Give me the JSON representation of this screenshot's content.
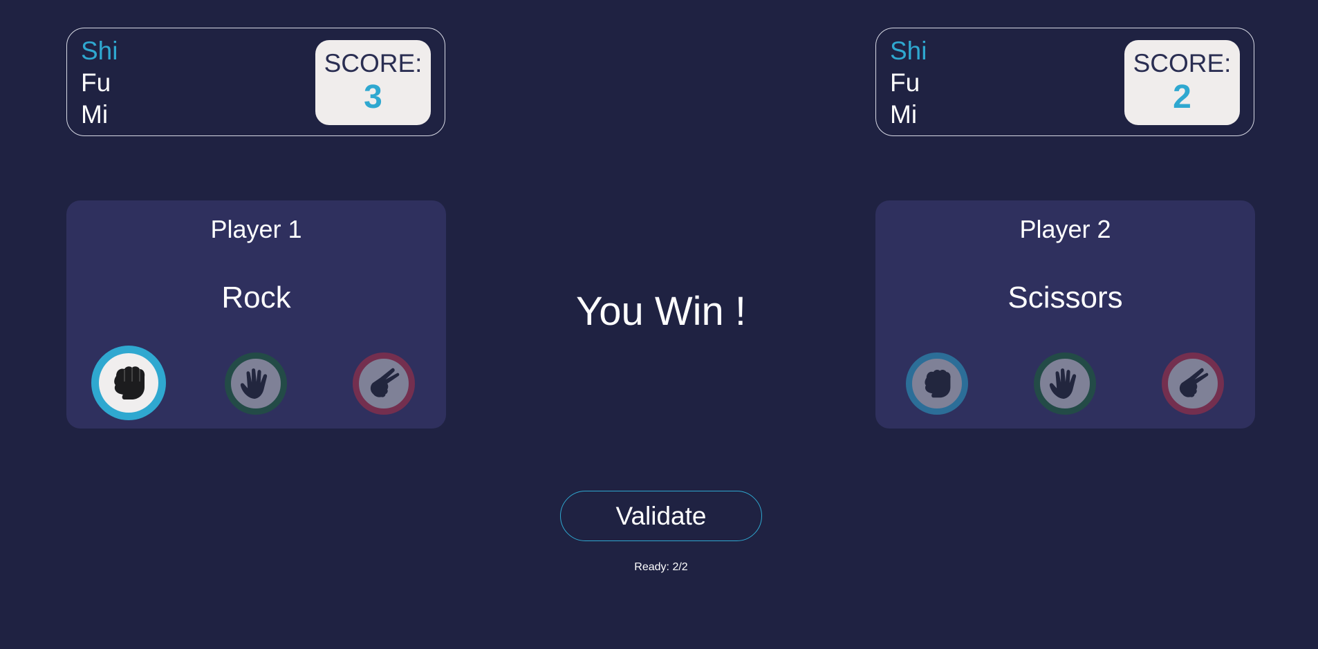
{
  "title_words": [
    "Shi",
    "Fu",
    "Mi"
  ],
  "score_label": "SCORE:",
  "players": [
    {
      "name": "Player 1",
      "choice": "Rock",
      "score": "3",
      "selected_option": "rock"
    },
    {
      "name": "Player 2",
      "choice": "Scissors",
      "score": "2",
      "selected_option": "none"
    }
  ],
  "options": [
    {
      "id": "rock",
      "icon": "rock-fist-icon"
    },
    {
      "id": "paper",
      "icon": "paper-hand-icon"
    },
    {
      "id": "scissors",
      "icon": "scissors-hand-icon"
    }
  ],
  "colors": {
    "background": "#1f2242",
    "card": "#2f305e",
    "accent": "#2fa8d0",
    "rock_ring": "#2c6e98",
    "paper_ring": "#234b47",
    "scissors_ring": "#742f4f"
  },
  "result_text": "You Win !",
  "validate_label": "Validate",
  "ready_status": "Ready: 2/2"
}
